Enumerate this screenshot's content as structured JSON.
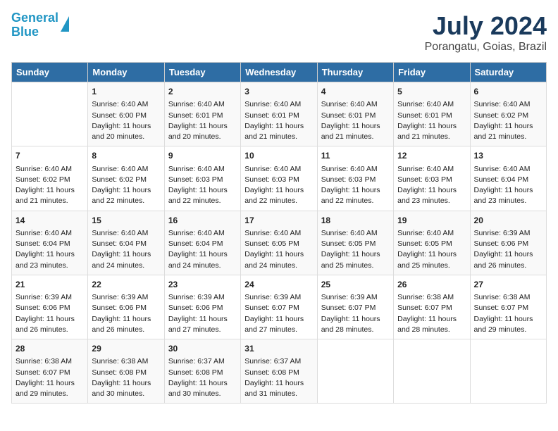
{
  "header": {
    "logo_line1": "General",
    "logo_line2": "Blue",
    "title": "July 2024",
    "subtitle": "Porangatu, Goias, Brazil"
  },
  "calendar": {
    "weekdays": [
      "Sunday",
      "Monday",
      "Tuesday",
      "Wednesday",
      "Thursday",
      "Friday",
      "Saturday"
    ],
    "weeks": [
      [
        {
          "day": "",
          "info": ""
        },
        {
          "day": "1",
          "info": "Sunrise: 6:40 AM\nSunset: 6:00 PM\nDaylight: 11 hours\nand 20 minutes."
        },
        {
          "day": "2",
          "info": "Sunrise: 6:40 AM\nSunset: 6:01 PM\nDaylight: 11 hours\nand 20 minutes."
        },
        {
          "day": "3",
          "info": "Sunrise: 6:40 AM\nSunset: 6:01 PM\nDaylight: 11 hours\nand 21 minutes."
        },
        {
          "day": "4",
          "info": "Sunrise: 6:40 AM\nSunset: 6:01 PM\nDaylight: 11 hours\nand 21 minutes."
        },
        {
          "day": "5",
          "info": "Sunrise: 6:40 AM\nSunset: 6:01 PM\nDaylight: 11 hours\nand 21 minutes."
        },
        {
          "day": "6",
          "info": "Sunrise: 6:40 AM\nSunset: 6:02 PM\nDaylight: 11 hours\nand 21 minutes."
        }
      ],
      [
        {
          "day": "7",
          "info": "Sunrise: 6:40 AM\nSunset: 6:02 PM\nDaylight: 11 hours\nand 21 minutes."
        },
        {
          "day": "8",
          "info": "Sunrise: 6:40 AM\nSunset: 6:02 PM\nDaylight: 11 hours\nand 22 minutes."
        },
        {
          "day": "9",
          "info": "Sunrise: 6:40 AM\nSunset: 6:03 PM\nDaylight: 11 hours\nand 22 minutes."
        },
        {
          "day": "10",
          "info": "Sunrise: 6:40 AM\nSunset: 6:03 PM\nDaylight: 11 hours\nand 22 minutes."
        },
        {
          "day": "11",
          "info": "Sunrise: 6:40 AM\nSunset: 6:03 PM\nDaylight: 11 hours\nand 22 minutes."
        },
        {
          "day": "12",
          "info": "Sunrise: 6:40 AM\nSunset: 6:03 PM\nDaylight: 11 hours\nand 23 minutes."
        },
        {
          "day": "13",
          "info": "Sunrise: 6:40 AM\nSunset: 6:04 PM\nDaylight: 11 hours\nand 23 minutes."
        }
      ],
      [
        {
          "day": "14",
          "info": "Sunrise: 6:40 AM\nSunset: 6:04 PM\nDaylight: 11 hours\nand 23 minutes."
        },
        {
          "day": "15",
          "info": "Sunrise: 6:40 AM\nSunset: 6:04 PM\nDaylight: 11 hours\nand 24 minutes."
        },
        {
          "day": "16",
          "info": "Sunrise: 6:40 AM\nSunset: 6:04 PM\nDaylight: 11 hours\nand 24 minutes."
        },
        {
          "day": "17",
          "info": "Sunrise: 6:40 AM\nSunset: 6:05 PM\nDaylight: 11 hours\nand 24 minutes."
        },
        {
          "day": "18",
          "info": "Sunrise: 6:40 AM\nSunset: 6:05 PM\nDaylight: 11 hours\nand 25 minutes."
        },
        {
          "day": "19",
          "info": "Sunrise: 6:40 AM\nSunset: 6:05 PM\nDaylight: 11 hours\nand 25 minutes."
        },
        {
          "day": "20",
          "info": "Sunrise: 6:39 AM\nSunset: 6:06 PM\nDaylight: 11 hours\nand 26 minutes."
        }
      ],
      [
        {
          "day": "21",
          "info": "Sunrise: 6:39 AM\nSunset: 6:06 PM\nDaylight: 11 hours\nand 26 minutes."
        },
        {
          "day": "22",
          "info": "Sunrise: 6:39 AM\nSunset: 6:06 PM\nDaylight: 11 hours\nand 26 minutes."
        },
        {
          "day": "23",
          "info": "Sunrise: 6:39 AM\nSunset: 6:06 PM\nDaylight: 11 hours\nand 27 minutes."
        },
        {
          "day": "24",
          "info": "Sunrise: 6:39 AM\nSunset: 6:07 PM\nDaylight: 11 hours\nand 27 minutes."
        },
        {
          "day": "25",
          "info": "Sunrise: 6:39 AM\nSunset: 6:07 PM\nDaylight: 11 hours\nand 28 minutes."
        },
        {
          "day": "26",
          "info": "Sunrise: 6:38 AM\nSunset: 6:07 PM\nDaylight: 11 hours\nand 28 minutes."
        },
        {
          "day": "27",
          "info": "Sunrise: 6:38 AM\nSunset: 6:07 PM\nDaylight: 11 hours\nand 29 minutes."
        }
      ],
      [
        {
          "day": "28",
          "info": "Sunrise: 6:38 AM\nSunset: 6:07 PM\nDaylight: 11 hours\nand 29 minutes."
        },
        {
          "day": "29",
          "info": "Sunrise: 6:38 AM\nSunset: 6:08 PM\nDaylight: 11 hours\nand 30 minutes."
        },
        {
          "day": "30",
          "info": "Sunrise: 6:37 AM\nSunset: 6:08 PM\nDaylight: 11 hours\nand 30 minutes."
        },
        {
          "day": "31",
          "info": "Sunrise: 6:37 AM\nSunset: 6:08 PM\nDaylight: 11 hours\nand 31 minutes."
        },
        {
          "day": "",
          "info": ""
        },
        {
          "day": "",
          "info": ""
        },
        {
          "day": "",
          "info": ""
        }
      ]
    ]
  }
}
